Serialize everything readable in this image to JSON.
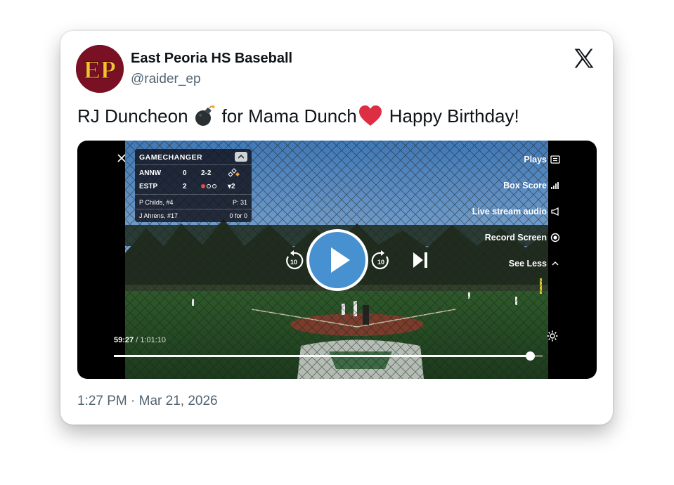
{
  "account": {
    "display_name": "East Peoria HS Baseball",
    "handle": "@raider_ep",
    "avatar_text": "EP",
    "avatar_bg": "#7a1023",
    "avatar_fg": "#f2c230"
  },
  "tweet": {
    "text_before": "RJ Duncheon",
    "text_middle": "for Mama Dunch",
    "text_after": "Happy Birthday!",
    "emojis": [
      "bomb-emoji",
      "red-heart-emoji"
    ],
    "timestamp": "1:27 PM · Mar 21, 2026"
  },
  "video": {
    "scoreboard": {
      "title": "GAMECHANGER",
      "teams": [
        {
          "name": "ANNW",
          "score": "0",
          "extra": "2-2"
        },
        {
          "name": "ESTP",
          "score": "2",
          "extra": "▾2"
        }
      ],
      "pitcher": {
        "name": "P Childs, #4",
        "stat": "P: 31"
      },
      "batter": {
        "name": "J Ahrens, #17",
        "stat": "0 for 0"
      }
    },
    "side_menu": [
      {
        "label": "Plays",
        "icon": "list-icon"
      },
      {
        "label": "Box Score",
        "icon": "bar-chart-icon"
      },
      {
        "label": "Live stream audio",
        "icon": "megaphone-icon"
      },
      {
        "label": "Record Screen",
        "icon": "record-icon"
      },
      {
        "label": "See Less",
        "icon": "chevron-up-icon"
      }
    ],
    "time_current": "59:27",
    "time_total": "/ 1:01:10",
    "progress": 0.971,
    "skip_back": "10",
    "skip_forward": "10",
    "play_color": "#4791d1"
  }
}
